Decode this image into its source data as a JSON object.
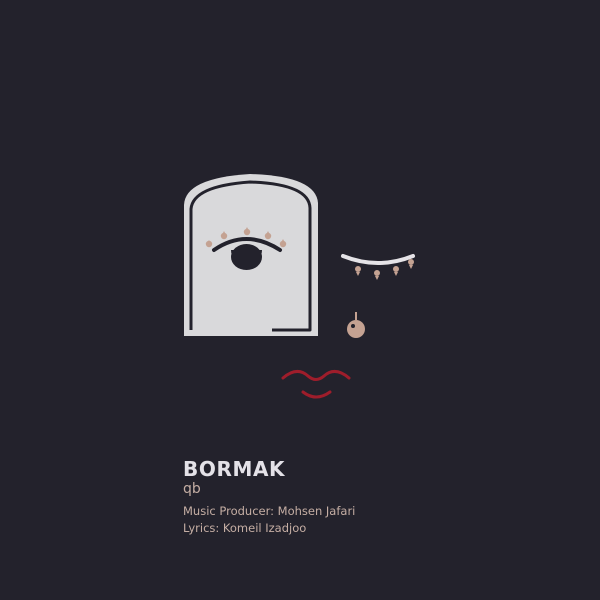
{
  "album": {
    "title": "BORMAK",
    "artist": "qb",
    "credits": {
      "producer": "Music Producer: Mohsen Jafari",
      "lyrics": "Lyrics: Komeil Izadjoo"
    }
  },
  "palette": {
    "background": "#23222c",
    "face_panel": "#d9d9db",
    "eye": "#23222c",
    "lashes_and_drop": "#c4a292",
    "closed_eye": "#e5e3e7",
    "lips": "#9e1d2b",
    "title_text": "#e4e2e8",
    "subtitle_text": "#c5aea4"
  },
  "icons": [
    "face-panel-icon",
    "open-eye-icon",
    "closed-eye-icon",
    "tear-drop-icon",
    "lips-icon"
  ]
}
